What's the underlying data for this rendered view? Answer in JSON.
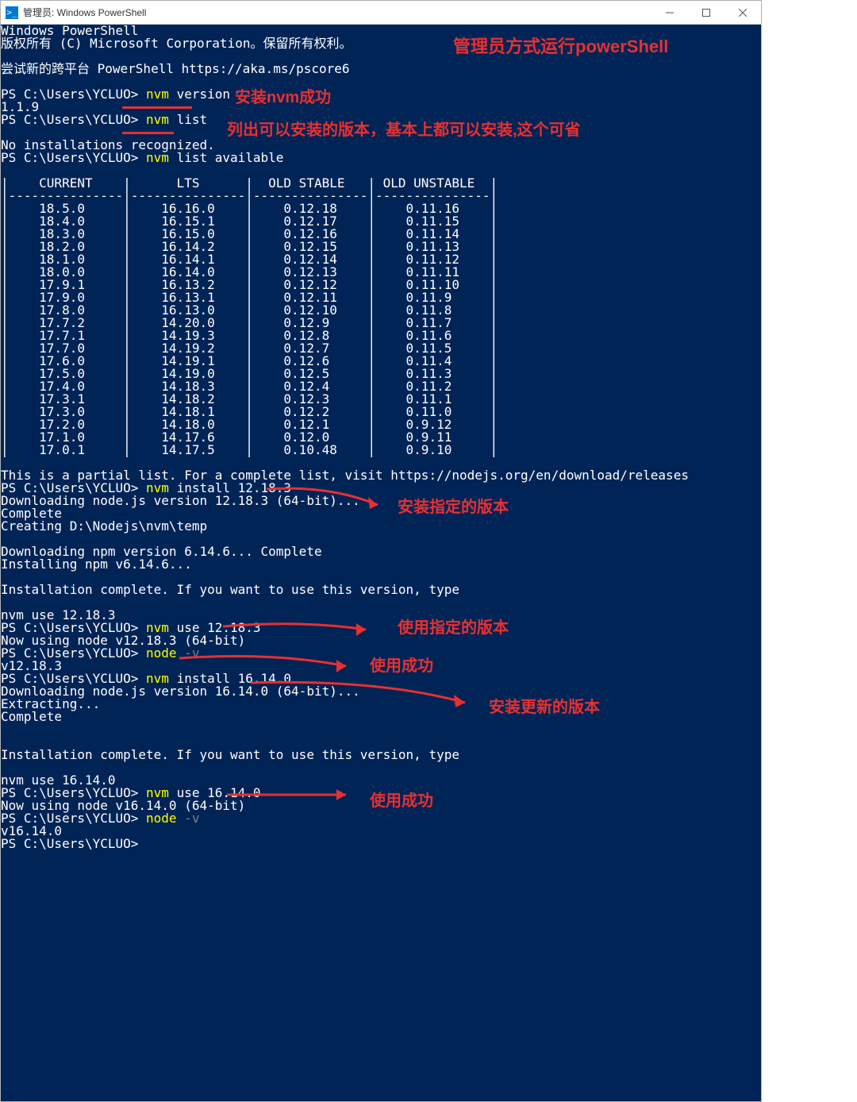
{
  "window": {
    "title": "管理员: Windows PowerShell",
    "icon_glyph": ">_"
  },
  "prompt_path": "PS C:\\Users\\YCLUO>",
  "banner": {
    "l1": "Windows PowerShell",
    "l2": "版权所有 (C) Microsoft Corporation。保留所有权利。",
    "l3": "尝试新的跨平台 PowerShell https://aka.ms/pscore6"
  },
  "cmds": {
    "nvm_version": "nvm version",
    "nvm_version_out": "1.1.9",
    "nvm_list": "nvm list",
    "nvm_list_out": "No installations recognized.",
    "nvm_list_available": "nvm list available",
    "nvm_install_12": "nvm install 12.18.3",
    "downloading_12": "Downloading node.js version 12.18.3 (64-bit)...",
    "complete": "Complete",
    "creating_temp": "Creating D:\\Nodejs\\nvm\\temp",
    "downloading_npm": "Downloading npm version 6.14.6... Complete",
    "installing_npm": "Installing npm v6.14.6...",
    "install_complete": "Installation complete. If you want to use this version, type",
    "nvm_use_12_hint": "nvm use 12.18.3",
    "nvm_use_12": "nvm use 12.18.3",
    "now_using_12": "Now using node v12.18.3 (64-bit)",
    "node_v": "node -v",
    "node_v_out_12": "v12.18.3",
    "nvm_install_16": "nvm install 16.14.0",
    "downloading_16": "Downloading node.js version 16.14.0 (64-bit)...",
    "extracting": "Extracting...",
    "nvm_use_16_hint": "nvm use 16.14.0",
    "nvm_use_16": "nvm use 16.14.0",
    "now_using_16": "Now using node v16.14.0 (64-bit)",
    "node_v_out_16": "v16.14.0"
  },
  "table": {
    "headers": [
      "CURRENT",
      "LTS",
      "OLD STABLE",
      "OLD UNSTABLE"
    ],
    "rows": [
      [
        "18.5.0",
        "16.16.0",
        "0.12.18",
        "0.11.16"
      ],
      [
        "18.4.0",
        "16.15.1",
        "0.12.17",
        "0.11.15"
      ],
      [
        "18.3.0",
        "16.15.0",
        "0.12.16",
        "0.11.14"
      ],
      [
        "18.2.0",
        "16.14.2",
        "0.12.15",
        "0.11.13"
      ],
      [
        "18.1.0",
        "16.14.1",
        "0.12.14",
        "0.11.12"
      ],
      [
        "18.0.0",
        "16.14.0",
        "0.12.13",
        "0.11.11"
      ],
      [
        "17.9.1",
        "16.13.2",
        "0.12.12",
        "0.11.10"
      ],
      [
        "17.9.0",
        "16.13.1",
        "0.12.11",
        "0.11.9"
      ],
      [
        "17.8.0",
        "16.13.0",
        "0.12.10",
        "0.11.8"
      ],
      [
        "17.7.2",
        "14.20.0",
        "0.12.9",
        "0.11.7"
      ],
      [
        "17.7.1",
        "14.19.3",
        "0.12.8",
        "0.11.6"
      ],
      [
        "17.7.0",
        "14.19.2",
        "0.12.7",
        "0.11.5"
      ],
      [
        "17.6.0",
        "14.19.1",
        "0.12.6",
        "0.11.4"
      ],
      [
        "17.5.0",
        "14.19.0",
        "0.12.5",
        "0.11.3"
      ],
      [
        "17.4.0",
        "14.18.3",
        "0.12.4",
        "0.11.2"
      ],
      [
        "17.3.1",
        "14.18.2",
        "0.12.3",
        "0.11.1"
      ],
      [
        "17.3.0",
        "14.18.1",
        "0.12.2",
        "0.11.0"
      ],
      [
        "17.2.0",
        "14.18.0",
        "0.12.1",
        "0.9.12"
      ],
      [
        "17.1.0",
        "14.17.6",
        "0.12.0",
        "0.9.11"
      ],
      [
        "17.0.1",
        "14.17.5",
        "0.10.48",
        "0.9.10"
      ]
    ],
    "footer": "This is a partial list. For a complete list, visit https://nodejs.org/en/download/releases"
  },
  "annotations": {
    "admin_run": "管理员方式运行powerShell",
    "install_nvm_ok": "安装nvm成功",
    "list_versions": "列出可以安装的版本，基本上都可以安装,这个可省",
    "install_specific": "安装指定的版本",
    "use_specific": "使用指定的版本",
    "use_ok": "使用成功",
    "install_newer": "安装更新的版本",
    "use_ok2": "使用成功"
  }
}
